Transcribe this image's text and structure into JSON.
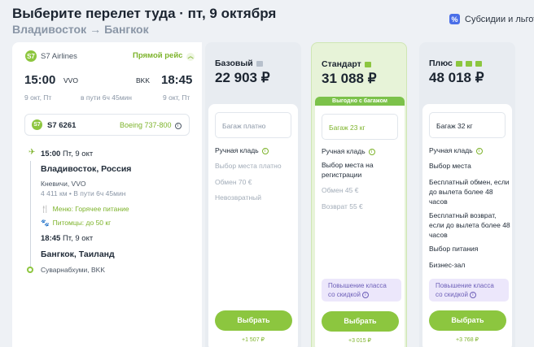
{
  "header": {
    "title": "Выберите перелет туда · пт, 9 октября",
    "route_from": "Владивосток",
    "route_arrow": "→",
    "route_to": "Бангкок",
    "subsidies_icon": "%",
    "subsidies_label": "Субсидии и льготы"
  },
  "flight": {
    "airline_logo": "S7",
    "airline": "S7 Airlines",
    "direct": "Прямой рейс",
    "dep_time": "15:00",
    "dep_code": "VVO",
    "arr_code": "BKK",
    "arr_time": "18:45",
    "dep_date": "9 окт, Пт",
    "duration": "в пути 6ч 45мин",
    "arr_date": "9 окт, Пт",
    "flight_number": "S7 6261",
    "aircraft": "Boeing 737-800",
    "seg_dep_time": "15:00",
    "seg_dep_date": "Пт, 9 окт",
    "seg_dep_city": "Владивосток, Россия",
    "seg_dep_airport": "Кневичи, VVO",
    "seg_info": "4 411 км • В пути 6ч 45мин",
    "meal": "Меню: Горячее питание",
    "pets": "Питомцы: до 50 кг",
    "seg_arr_time": "18:45",
    "seg_arr_date": "Пт, 9 окт",
    "seg_arr_city": "Бангкок, Таиланд",
    "seg_arr_airport": "Суварнабхуми, BKK"
  },
  "tariffs": [
    {
      "name": "Базовый",
      "price": "22 903 ₽",
      "baggage": "Багаж платно",
      "features": [
        "Ручная кладь",
        "Выбор места платно",
        "Обмен 70 €",
        "Невозвратный"
      ],
      "select": "Выбрать",
      "delta": "+1 507 ₽"
    },
    {
      "name": "Стандарт",
      "price": "31 088 ₽",
      "badge": "Выгодно с багажом",
      "baggage": "Багаж 23 кг",
      "features": [
        "Ручная кладь",
        "Выбор места на регистрации",
        "Обмен 45 €",
        "Возврат 55 €"
      ],
      "upgrade": "Повышение класса со скидкой",
      "select": "Выбрать",
      "delta": "+3 015 ₽"
    },
    {
      "name": "Плюс",
      "price": "48 018 ₽",
      "baggage": "Багаж 32 кг",
      "features": [
        "Ручная кладь",
        "Выбор места",
        "Бесплатный обмен, если до вылета более 48 часов",
        "Бесплатный возврат, если до вылета более 48 часов",
        "Выбор питания",
        "Бизнес-зал"
      ],
      "upgrade": "Повышение класса со скидкой",
      "select": "Выбрать",
      "delta": "+3 768 ₽"
    }
  ],
  "colors": {
    "accent": "#8cc63f",
    "purple": "#6d5fb8"
  }
}
